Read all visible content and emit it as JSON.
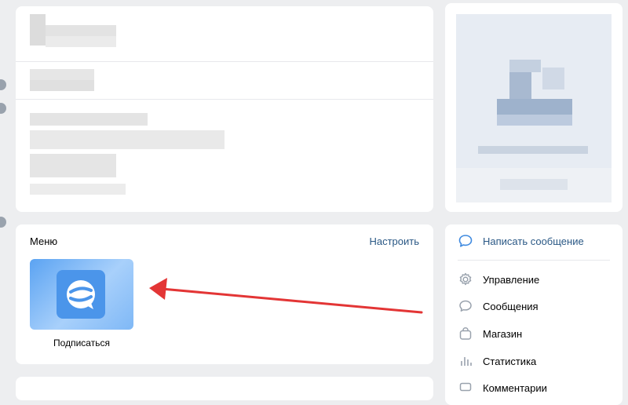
{
  "menu": {
    "title": "Меню",
    "configure_label": "Настроить",
    "app": {
      "label": "Подписаться",
      "icon": "chat-bubble-logo-icon"
    }
  },
  "actions": {
    "primary": {
      "label": "Написать сообщение",
      "icon": "message-icon"
    },
    "items": [
      {
        "label": "Управление",
        "icon": "gear-icon"
      },
      {
        "label": "Сообщения",
        "icon": "chat-icon"
      },
      {
        "label": "Магазин",
        "icon": "shopping-bag-icon"
      },
      {
        "label": "Статистика",
        "icon": "bar-chart-icon"
      },
      {
        "label": "Комментарии",
        "icon": "comment-icon"
      }
    ]
  },
  "colors": {
    "link": "#2a5885",
    "accent_icon": "#3f8ae0",
    "arrow": "#e33535",
    "background": "#edeef0"
  }
}
